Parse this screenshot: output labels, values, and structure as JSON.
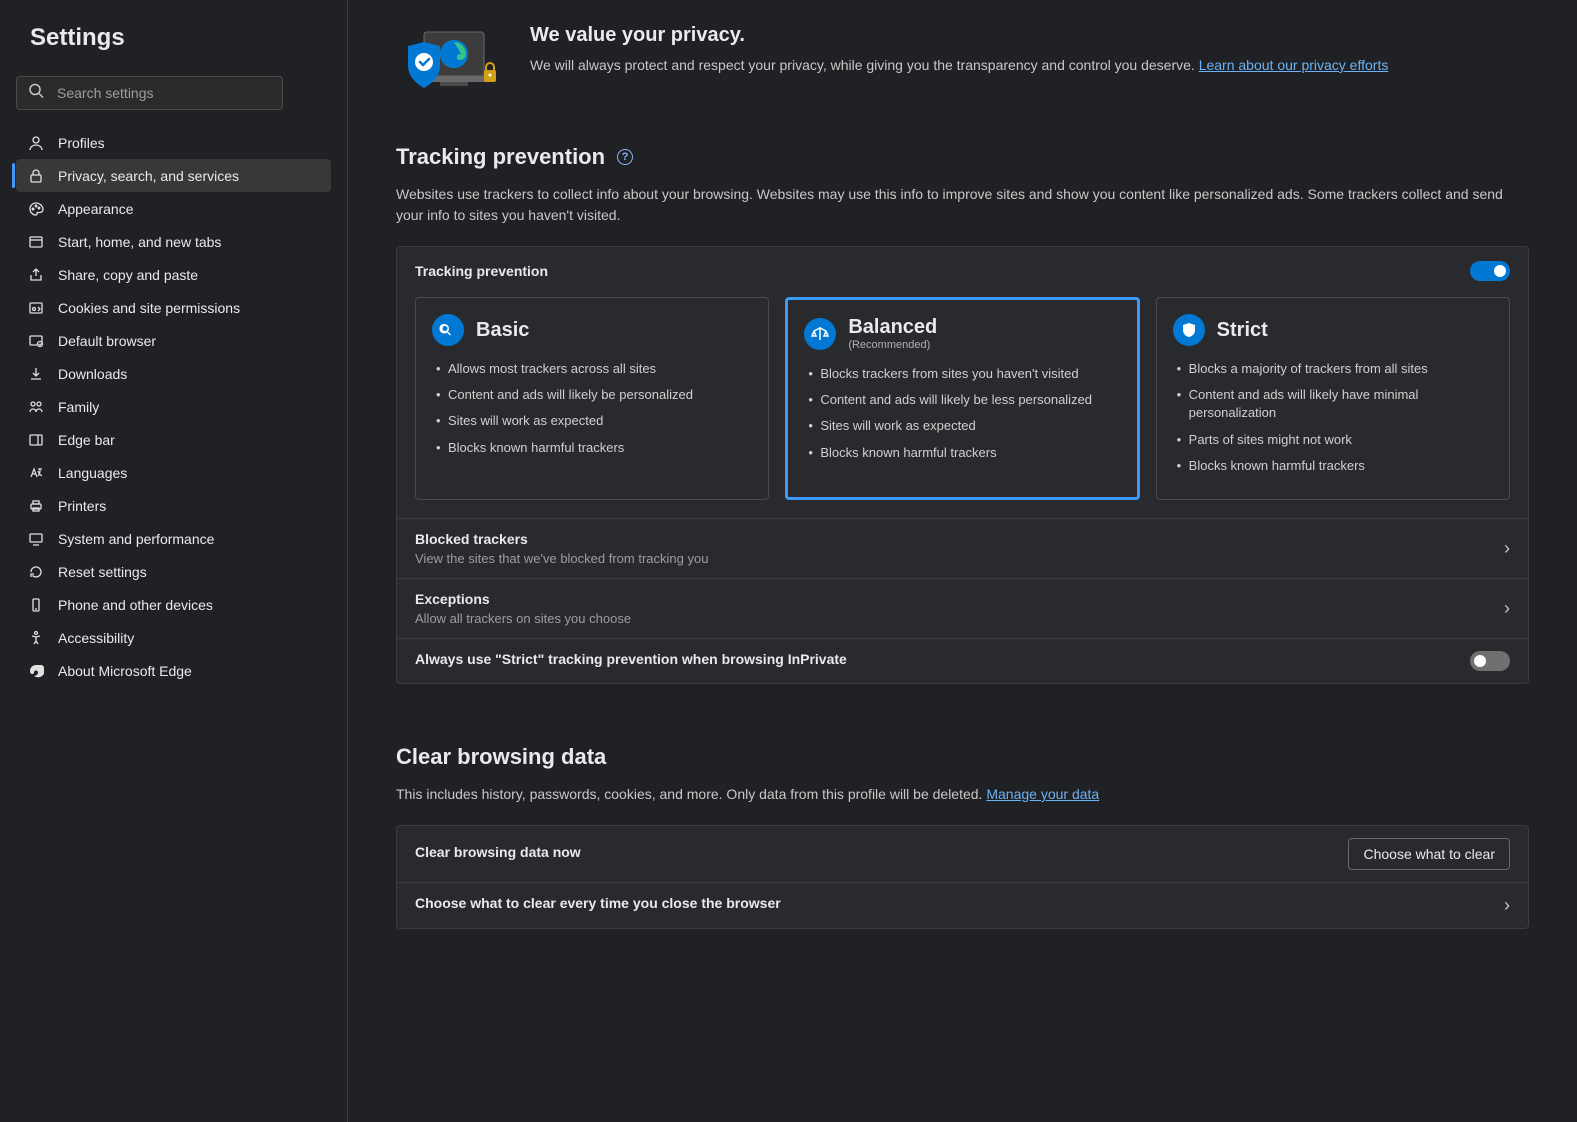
{
  "sidebar": {
    "title": "Settings",
    "search_placeholder": "Search settings",
    "items": [
      {
        "label": "Profiles"
      },
      {
        "label": "Privacy, search, and services"
      },
      {
        "label": "Appearance"
      },
      {
        "label": "Start, home, and new tabs"
      },
      {
        "label": "Share, copy and paste"
      },
      {
        "label": "Cookies and site permissions"
      },
      {
        "label": "Default browser"
      },
      {
        "label": "Downloads"
      },
      {
        "label": "Family"
      },
      {
        "label": "Edge bar"
      },
      {
        "label": "Languages"
      },
      {
        "label": "Printers"
      },
      {
        "label": "System and performance"
      },
      {
        "label": "Reset settings"
      },
      {
        "label": "Phone and other devices"
      },
      {
        "label": "Accessibility"
      },
      {
        "label": "About Microsoft Edge"
      }
    ]
  },
  "hero": {
    "title": "We value your privacy.",
    "body": "We will always protect and respect your privacy, while giving you the transparency and control you deserve. ",
    "link": "Learn about our privacy efforts"
  },
  "tracking": {
    "heading": "Tracking prevention",
    "desc": "Websites use trackers to collect info about your browsing. Websites may use this info to improve sites and show you content like personalized ads. Some trackers collect and send your info to sites you haven't visited.",
    "card_title": "Tracking prevention",
    "levels": [
      {
        "name": "Basic",
        "bullets": [
          "Allows most trackers across all sites",
          "Content and ads will likely be personalized",
          "Sites will work as expected",
          "Blocks known harmful trackers"
        ]
      },
      {
        "name": "Balanced",
        "sub": "(Recommended)",
        "bullets": [
          "Blocks trackers from sites you haven't visited",
          "Content and ads will likely be less personalized",
          "Sites will work as expected",
          "Blocks known harmful trackers"
        ]
      },
      {
        "name": "Strict",
        "bullets": [
          "Blocks a majority of trackers from all sites",
          "Content and ads will likely have minimal personalization",
          "Parts of sites might not work",
          "Blocks known harmful trackers"
        ]
      }
    ],
    "blocked_title": "Blocked trackers",
    "blocked_desc": "View the sites that we've blocked from tracking you",
    "exceptions_title": "Exceptions",
    "exceptions_desc": "Allow all trackers on sites you choose",
    "strict_inprivate": "Always use \"Strict\" tracking prevention when browsing InPrivate"
  },
  "clear": {
    "heading": "Clear browsing data",
    "desc_prefix": "This includes history, passwords, cookies, and more. Only data from this profile will be deleted. ",
    "link": "Manage your data",
    "now_title": "Clear browsing data now",
    "choose_btn": "Choose what to clear",
    "on_close_title": "Choose what to clear every time you close the browser"
  }
}
